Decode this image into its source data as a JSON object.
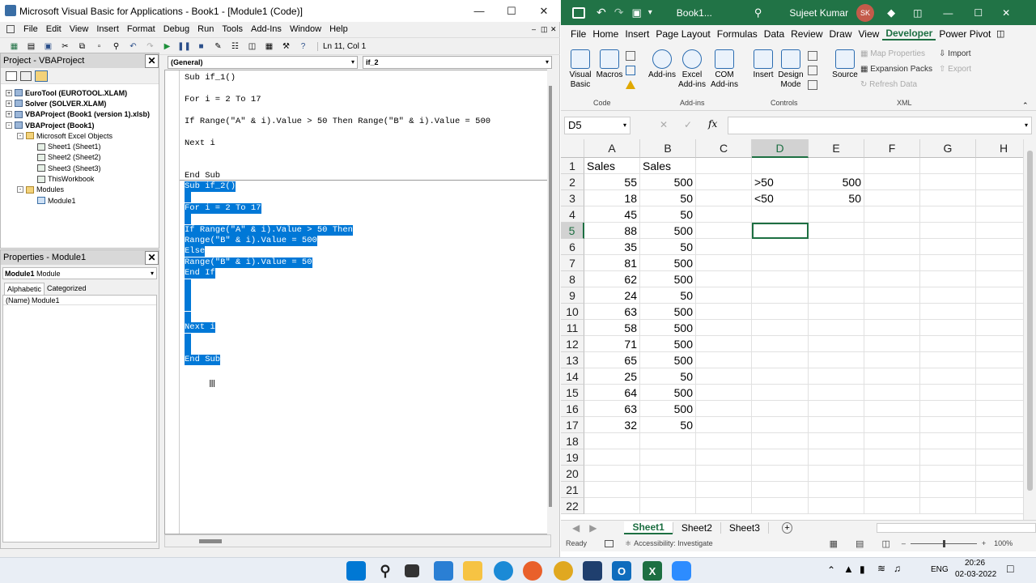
{
  "vbe": {
    "title": "Microsoft Visual Basic for Applications - Book1 - [Module1 (Code)]",
    "menu": [
      "File",
      "Edit",
      "View",
      "Insert",
      "Format",
      "Debug",
      "Run",
      "Tools",
      "Add-Ins",
      "Window",
      "Help"
    ],
    "cursor_pos": "Ln 11, Col 1",
    "project_title": "Project - VBAProject",
    "tree": [
      {
        "label": "EuroTool (EUROTOOL.XLAM)",
        "bold": true,
        "level": 0
      },
      {
        "label": "Solver (SOLVER.XLAM)",
        "bold": true,
        "level": 0
      },
      {
        "label": "VBAProject (Book1 (version 1).xlsb)",
        "bold": true,
        "level": 0
      },
      {
        "label": "VBAProject (Book1)",
        "bold": true,
        "level": 0
      },
      {
        "label": "Microsoft Excel Objects",
        "bold": false,
        "level": 1
      },
      {
        "label": "Sheet1 (Sheet1)",
        "bold": false,
        "level": 2
      },
      {
        "label": "Sheet2 (Sheet2)",
        "bold": false,
        "level": 2
      },
      {
        "label": "Sheet3 (Sheet3)",
        "bold": false,
        "level": 2
      },
      {
        "label": "ThisWorkbook",
        "bold": false,
        "level": 2
      },
      {
        "label": "Modules",
        "bold": false,
        "level": 1
      },
      {
        "label": "Module1",
        "bold": false,
        "level": 2
      }
    ],
    "props_title": "Properties - Module1",
    "props_object": "Module1",
    "props_object_type": "Module",
    "props_tabs": [
      "Alphabetic",
      "Categorized"
    ],
    "props_name_key": "(Name)",
    "props_name_val": "Module1",
    "combo_object": "(General)",
    "combo_proc": "if_2",
    "code": [
      {
        "text": "Sub if_1()",
        "sel": false
      },
      {
        "text": "",
        "sel": false
      },
      {
        "text": "For i = 2 To 17",
        "sel": false
      },
      {
        "text": "",
        "sel": false
      },
      {
        "text": "If Range(\"A\" & i).Value > 50 Then Range(\"B\" & i).Value = 500",
        "sel": false
      },
      {
        "text": "",
        "sel": false
      },
      {
        "text": "Next i",
        "sel": false
      },
      {
        "text": "",
        "sel": false
      },
      {
        "text": "",
        "sel": false
      },
      {
        "text": "End Sub",
        "sel": false
      },
      {
        "text": "Sub if_2()",
        "sel": true
      },
      {
        "text": "",
        "sel": true
      },
      {
        "text": "For i = 2 To 17",
        "sel": true
      },
      {
        "text": "",
        "sel": true
      },
      {
        "text": "If Range(\"A\" & i).Value > 50 Then",
        "sel": true
      },
      {
        "text": "Range(\"B\" & i).Value = 500",
        "sel": true
      },
      {
        "text": "Else",
        "sel": true
      },
      {
        "text": "Range(\"B\" & i).Value = 50",
        "sel": true
      },
      {
        "text": "End If",
        "sel": true
      },
      {
        "text": "",
        "sel": true
      },
      {
        "text": "",
        "sel": true
      },
      {
        "text": "",
        "sel": true
      },
      {
        "text": "",
        "sel": true
      },
      {
        "text": "Next i",
        "sel": true
      },
      {
        "text": "",
        "sel": true
      },
      {
        "text": "",
        "sel": true
      },
      {
        "text": "End Sub",
        "sel": true
      }
    ]
  },
  "excel": {
    "title": "Book1...",
    "user": "Sujeet Kumar",
    "user_initials": "SK",
    "tabs": [
      "File",
      "Home",
      "Insert",
      "Page Layout",
      "Formulas",
      "Data",
      "Review",
      "Draw",
      "View",
      "Developer",
      "Power Pivot"
    ],
    "active_tab": "Developer",
    "ribbon": {
      "visual_basic": "Visual Basic",
      "macros": "Macros",
      "addins": "Add-ins",
      "excel_addins": "Excel Add-ins",
      "com_addins": "COM Add-ins",
      "insert": "Insert",
      "design_mode": "Design Mode",
      "source": "Source",
      "map_properties": "Map Properties",
      "expansion_packs": "Expansion Packs",
      "refresh_data": "Refresh Data",
      "import": "Import",
      "export": "Export",
      "groups": [
        "Code",
        "Add-ins",
        "Controls",
        "XML"
      ]
    },
    "name_box": "D5",
    "formula": "",
    "columns": [
      "A",
      "B",
      "C",
      "D",
      "E",
      "F",
      "G",
      "H"
    ],
    "rows": [
      [
        "Sales",
        "Sales",
        "",
        "",
        "",
        "",
        "",
        ""
      ],
      [
        "55",
        "500",
        "",
        ">50",
        "500",
        "",
        "",
        ""
      ],
      [
        "18",
        "50",
        "",
        "<50",
        "50",
        "",
        "",
        ""
      ],
      [
        "45",
        "50",
        "",
        "",
        "",
        "",
        "",
        ""
      ],
      [
        "88",
        "500",
        "",
        "",
        "",
        "",
        "",
        ""
      ],
      [
        "35",
        "50",
        "",
        "",
        "",
        "",
        "",
        ""
      ],
      [
        "81",
        "500",
        "",
        "",
        "",
        "",
        "",
        ""
      ],
      [
        "62",
        "500",
        "",
        "",
        "",
        "",
        "",
        ""
      ],
      [
        "24",
        "50",
        "",
        "",
        "",
        "",
        "",
        ""
      ],
      [
        "63",
        "500",
        "",
        "",
        "",
        "",
        "",
        ""
      ],
      [
        "58",
        "500",
        "",
        "",
        "",
        "",
        "",
        ""
      ],
      [
        "71",
        "500",
        "",
        "",
        "",
        "",
        "",
        ""
      ],
      [
        "65",
        "500",
        "",
        "",
        "",
        "",
        "",
        ""
      ],
      [
        "25",
        "50",
        "",
        "",
        "",
        "",
        "",
        ""
      ],
      [
        "64",
        "500",
        "",
        "",
        "",
        "",
        "",
        ""
      ],
      [
        "63",
        "500",
        "",
        "",
        "",
        "",
        "",
        ""
      ],
      [
        "32",
        "50",
        "",
        "",
        "",
        "",
        "",
        ""
      ],
      [
        "",
        "",
        "",
        "",
        "",
        "",
        "",
        ""
      ],
      [
        "",
        "",
        "",
        "",
        "",
        "",
        "",
        ""
      ],
      [
        "",
        "",
        "",
        "",
        "",
        "",
        "",
        ""
      ],
      [
        "",
        "",
        "",
        "",
        "",
        "",
        "",
        ""
      ],
      [
        "",
        "",
        "",
        "",
        "",
        "",
        "",
        ""
      ]
    ],
    "sheets": [
      "Sheet1",
      "Sheet2",
      "Sheet3"
    ],
    "active_sheet": "Sheet1",
    "status_ready": "Ready",
    "status_access": "Accessibility: Investigate",
    "zoom": "100%"
  },
  "taskbar": {
    "lang": "ENG",
    "time": "20:26",
    "date": "02-03-2022"
  }
}
